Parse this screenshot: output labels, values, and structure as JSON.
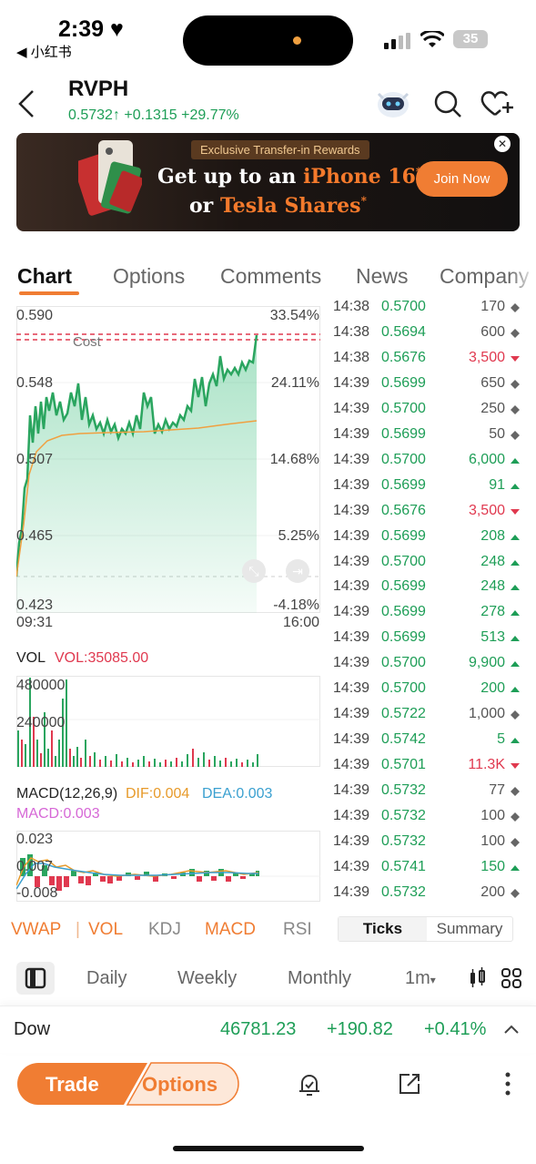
{
  "status_bar": {
    "time": "2:39",
    "back_app": "◀ 小红书",
    "battery": "35"
  },
  "header": {
    "ticker": "RVPH",
    "price": "0.5732",
    "change": "+0.1315",
    "change_pct": "+29.77%"
  },
  "banner": {
    "tag": "Exclusive Transfer-in Rewards",
    "line1_a": "Get up to an ",
    "line1_b": "iPhone 16",
    "line2_a": "or ",
    "line2_b": "Tesla Shares",
    "cta": "Join Now",
    "close": "✕"
  },
  "tabs": [
    "Chart",
    "Options",
    "Comments",
    "News",
    "Company"
  ],
  "price_chart": {
    "left_axis": [
      "0.590",
      "0.548",
      "0.507",
      "0.465",
      "0.423"
    ],
    "right_axis": [
      "33.54%",
      "24.11%",
      "14.68%",
      "5.25%",
      "-4.18%"
    ],
    "x_start": "09:31",
    "x_end": "16:00",
    "cost_label": "Cost"
  },
  "vol_chart": {
    "title": "VOL",
    "value": "VOL:35085.00",
    "y1": "480000",
    "y2": "240000"
  },
  "macd_chart": {
    "title": "MACD(12,26,9)",
    "dif": "DIF:0.004",
    "dea": "DEA:0.003",
    "macd": "MACD:0.003",
    "y1": "0.023",
    "y2": "0.007",
    "y3": "-0.008"
  },
  "ticks": [
    {
      "time": "14:38",
      "price": "0.5700",
      "vol": "170",
      "dir": "neutral"
    },
    {
      "time": "14:38",
      "price": "0.5694",
      "vol": "600",
      "dir": "neutral"
    },
    {
      "time": "14:38",
      "price": "0.5676",
      "vol": "3,500",
      "dir": "down"
    },
    {
      "time": "14:39",
      "price": "0.5699",
      "vol": "650",
      "dir": "neutral"
    },
    {
      "time": "14:39",
      "price": "0.5700",
      "vol": "250",
      "dir": "neutral"
    },
    {
      "time": "14:39",
      "price": "0.5699",
      "vol": "50",
      "dir": "neutral"
    },
    {
      "time": "14:39",
      "price": "0.5700",
      "vol": "6,000",
      "dir": "up"
    },
    {
      "time": "14:39",
      "price": "0.5699",
      "vol": "91",
      "dir": "up"
    },
    {
      "time": "14:39",
      "price": "0.5676",
      "vol": "3,500",
      "dir": "down"
    },
    {
      "time": "14:39",
      "price": "0.5699",
      "vol": "208",
      "dir": "up"
    },
    {
      "time": "14:39",
      "price": "0.5700",
      "vol": "248",
      "dir": "up"
    },
    {
      "time": "14:39",
      "price": "0.5699",
      "vol": "248",
      "dir": "up"
    },
    {
      "time": "14:39",
      "price": "0.5699",
      "vol": "278",
      "dir": "up"
    },
    {
      "time": "14:39",
      "price": "0.5699",
      "vol": "513",
      "dir": "up"
    },
    {
      "time": "14:39",
      "price": "0.5700",
      "vol": "9,900",
      "dir": "up"
    },
    {
      "time": "14:39",
      "price": "0.5700",
      "vol": "200",
      "dir": "up"
    },
    {
      "time": "14:39",
      "price": "0.5722",
      "vol": "1,000",
      "dir": "neutral"
    },
    {
      "time": "14:39",
      "price": "0.5742",
      "vol": "5",
      "dir": "up"
    },
    {
      "time": "14:39",
      "price": "0.5701",
      "vol": "11.3K",
      "dir": "down"
    },
    {
      "time": "14:39",
      "price": "0.5732",
      "vol": "77",
      "dir": "neutral"
    },
    {
      "time": "14:39",
      "price": "0.5732",
      "vol": "100",
      "dir": "neutral"
    },
    {
      "time": "14:39",
      "price": "0.5732",
      "vol": "100",
      "dir": "neutral"
    },
    {
      "time": "14:39",
      "price": "0.5741",
      "vol": "150",
      "dir": "up"
    },
    {
      "time": "14:39",
      "price": "0.5732",
      "vol": "200",
      "dir": "neutral"
    }
  ],
  "indicators": {
    "vwap": "VWAP",
    "vol": "VOL",
    "kdj": "KDJ",
    "macd": "MACD",
    "rsi": "RSI",
    "ticks": "Ticks",
    "summary": "Summary"
  },
  "periods": {
    "daily": "Daily",
    "weekly": "Weekly",
    "monthly": "Monthly",
    "interval": "1m"
  },
  "index": {
    "name": "Dow",
    "value": "46781.23",
    "change": "+190.82",
    "pct": "+0.41%"
  },
  "bottom": {
    "trade": "Trade",
    "options": "Options"
  },
  "colors": {
    "up": "#1e9e57",
    "down": "#e0394f",
    "accent": "#f07d33"
  }
}
